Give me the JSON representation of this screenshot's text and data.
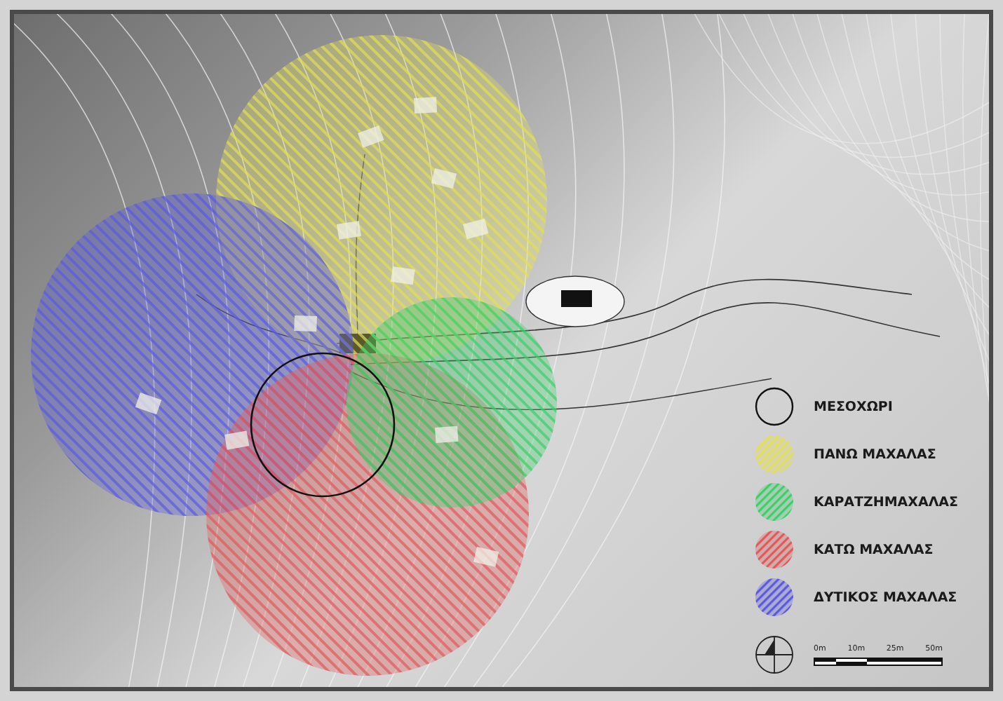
{
  "legend": {
    "items": [
      {
        "kind": "outline",
        "label": "ΜΕΣΟΧΩΡΙ",
        "color": "#111111"
      },
      {
        "kind": "hatched",
        "label": "ΠΑΝΩ ΜΑΧΑΛΑΣ",
        "color": "#e2e05a"
      },
      {
        "kind": "hatched",
        "label": "ΚΑΡΑΤΖΗΜΑΧΑΛΑΣ",
        "color": "#3fcf6a"
      },
      {
        "kind": "hatched",
        "label": "ΚΑΤΩ ΜΑΧΑΛΑΣ",
        "color": "#e05a5a"
      },
      {
        "kind": "hatched",
        "label": "ΔΥΤΙΚΟΣ ΜΑΧΑΛΑΣ",
        "color": "#5a5ae0"
      }
    ]
  },
  "scale": {
    "ticks": [
      "0m",
      "10m",
      "25m",
      "50m"
    ]
  }
}
